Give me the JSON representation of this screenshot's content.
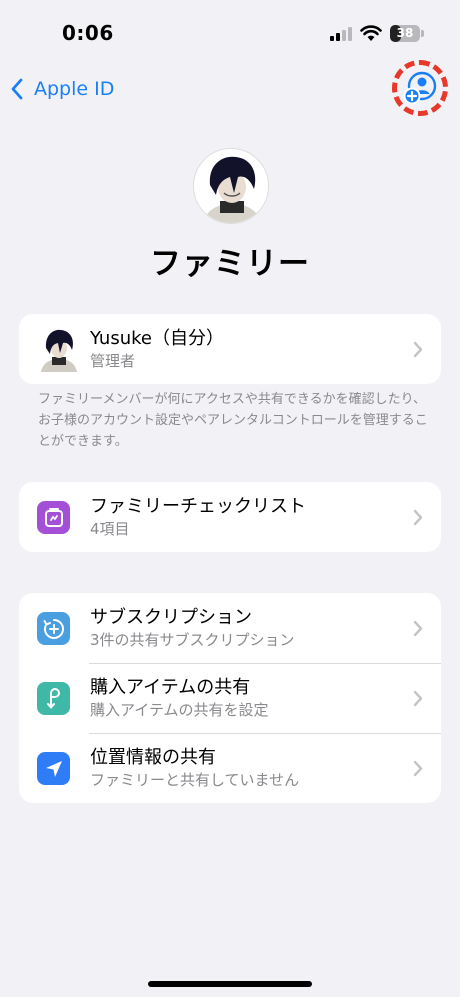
{
  "status": {
    "time": "0:06",
    "battery": "38",
    "battery_level": 0.38
  },
  "nav": {
    "back_label": "Apple ID",
    "add_member_icon": "person-add-icon"
  },
  "header": {
    "title": "ファミリー"
  },
  "member": {
    "name": "Yusuke（自分）",
    "role": "管理者"
  },
  "footnote": "ファミリーメンバーが何にアクセスや共有できるかを確認したり、お子様のアカウント設定やペアレンタルコントロールを管理することができます。",
  "checklist": {
    "title": "ファミリーチェックリスト",
    "subtitle": "4項目",
    "icon": "checklist-icon",
    "color": "#a34fd6"
  },
  "features": [
    {
      "title": "サブスクリプション",
      "subtitle": "3件の共有サブスクリプション",
      "icon": "subscription-icon",
      "color": "#4a9fe0"
    },
    {
      "title": "購入アイテムの共有",
      "subtitle": "購入アイテムの共有を設定",
      "icon": "purchase-sharing-icon",
      "color": "#3fb8a8"
    },
    {
      "title": "位置情報の共有",
      "subtitle": "ファミリーと共有していません",
      "icon": "location-icon",
      "color": "#2e7cf6"
    }
  ],
  "colors": {
    "accent": "#1a7ff7",
    "background": "#f2f2f6",
    "highlight_ring": "#e8372b"
  }
}
